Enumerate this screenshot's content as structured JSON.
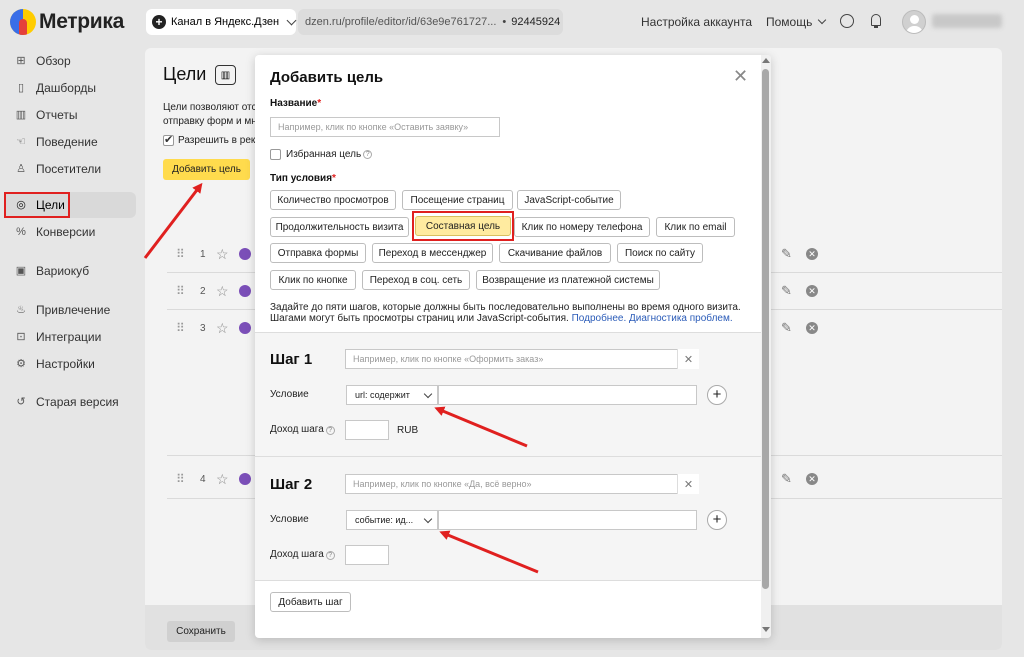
{
  "header": {
    "logo_text": "Метрика",
    "counter_name": "Канал в Яндекс.Дзен",
    "url": "dzen.ru/profile/editor/id/63e9e761727...",
    "counter_id": "92445924",
    "account_settings": "Настройка аккаунта",
    "help": "Помощь"
  },
  "sidebar": {
    "items": [
      {
        "label": "Обзор",
        "icon": "grid-icon"
      },
      {
        "label": "Дашборды",
        "icon": "dashboard-icon"
      },
      {
        "label": "Отчеты",
        "icon": "reports-icon"
      },
      {
        "label": "Поведение",
        "icon": "behavior-icon"
      },
      {
        "label": "Посетители",
        "icon": "visitors-icon"
      },
      {
        "label": "Цели",
        "icon": "target-icon"
      },
      {
        "label": "Конверсии",
        "icon": "percent-icon"
      },
      {
        "label": "Вариокуб",
        "icon": "variocube-icon"
      },
      {
        "label": "Привлечение",
        "icon": "flame-icon"
      },
      {
        "label": "Интеграции",
        "icon": "integrations-icon"
      },
      {
        "label": "Настройки",
        "icon": "gear-icon"
      },
      {
        "label": "Старая версия",
        "icon": "history-icon"
      }
    ],
    "active": "Цели"
  },
  "page": {
    "title": "Цели",
    "desc_line1": "Цели позволяют отсл",
    "desc_line2": "отправку форм и мно",
    "allow_label": "Разрешить в рекл",
    "add_goal": "Добавить цель",
    "goal_numbers": [
      "1",
      "2",
      "3",
      "4"
    ],
    "save": "Сохранить"
  },
  "modal": {
    "title": "Добавить цель",
    "name_label": "Название",
    "required_mark": "*",
    "name_placeholder": "Например, клик по кнопке «Оставить заявку»",
    "favorite_label": "Избранная цель",
    "condition_type_label": "Тип условия",
    "condition_types": [
      "Количество просмотров",
      "Посещение страниц",
      "JavaScript-событие",
      "Продолжительность визита",
      "Составная цель",
      "Клик по номеру телефона",
      "Клик по email",
      "Отправка формы",
      "Переход в мессенджер",
      "Скачивание файлов",
      "Поиск по сайту",
      "Клик по кнопке",
      "Переход в соц. сеть",
      "Возвращение из платежной системы"
    ],
    "selected_type": "Составная цель",
    "note_line1": "Задайте до пяти шагов, которые должны быть последовательно выполнены во время одного визита.",
    "note_line2_prefix": "Шагами могут быть просмотры страниц или JavaScript-события.",
    "link_more": "Подробнее.",
    "link_diagnostics": "Диагностика проблем.",
    "steps": [
      {
        "title": "Шаг 1",
        "placeholder": "Например, клик по кнопке «Оформить заказ»",
        "condition_label": "Условие",
        "condition_value": "url: содержит",
        "income_label": "Доход шага",
        "currency": "RUB"
      },
      {
        "title": "Шаг 2",
        "placeholder": "Например, клик по кнопке «Да, всё верно»",
        "condition_label": "Условие",
        "condition_value": "событие: ид...",
        "income_label": "Доход шага",
        "currency": ""
      }
    ],
    "add_step": "Добавить шаг"
  },
  "colors": {
    "accent_yellow": "#ffdb4d",
    "selected_chip": "#ffeba0",
    "annotation_red": "#e0201f",
    "link_blue": "#2a5bb8"
  }
}
